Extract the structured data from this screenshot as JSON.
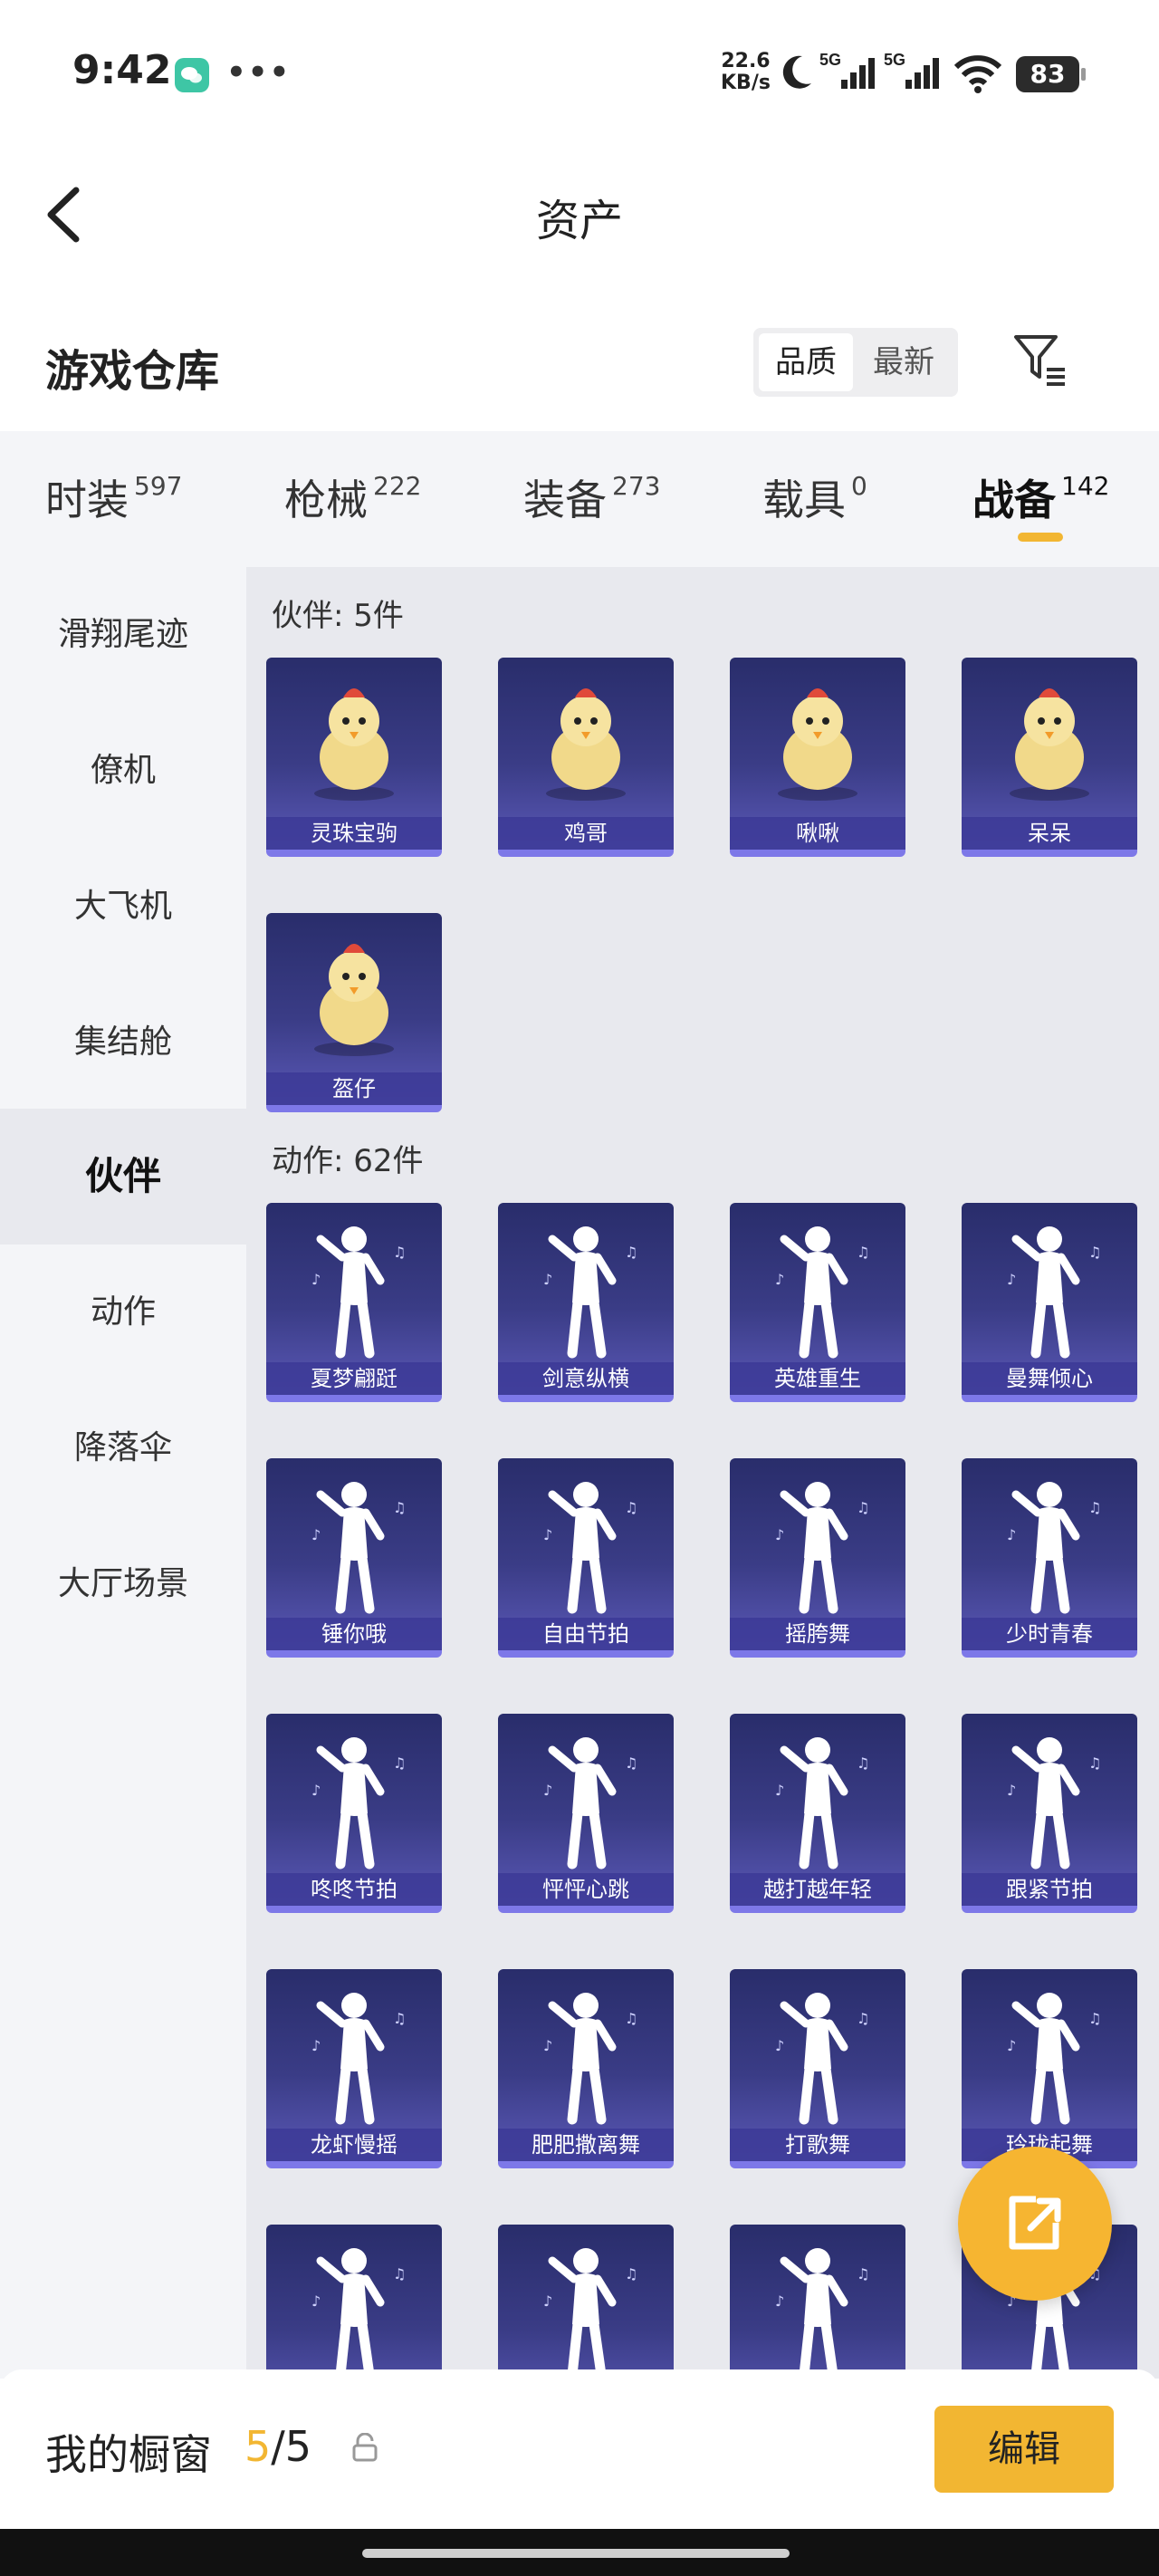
{
  "status_bar": {
    "time": "9:42",
    "net_speed_value": "22.6",
    "net_speed_unit": "KB/s",
    "battery": "83",
    "icons": [
      "wechat-icon",
      "more-dots-icon",
      "moon-icon",
      "signal-5g-icon",
      "signal-5g-icon",
      "wifi-icon",
      "battery-icon"
    ]
  },
  "nav": {
    "title": "资产",
    "back_icon": "chevron-left-icon"
  },
  "warehouse": {
    "title": "游戏仓库",
    "sort_options": [
      "品质",
      "最新"
    ],
    "sort_selected": "品质",
    "filter_icon": "filter-icon"
  },
  "category_tabs": [
    {
      "label": "时装",
      "count": "597"
    },
    {
      "label": "枪械",
      "count": "222"
    },
    {
      "label": "装备",
      "count": "273"
    },
    {
      "label": "载具",
      "count": "0"
    },
    {
      "label": "战备",
      "count": "142"
    }
  ],
  "active_tab": "战备",
  "sidebar": {
    "items": [
      "滑翔尾迹",
      "僚机",
      "大飞机",
      "集结舱",
      "伙伴",
      "动作",
      "降落伞",
      "大厅场景"
    ],
    "active": "伙伴"
  },
  "sections": {
    "partners": {
      "title": "伙伴: 5件",
      "items": [
        "灵珠宝驹",
        "鸡哥",
        "啾啾",
        "呆呆",
        "盔仔"
      ]
    },
    "emotes": {
      "title": "动作: 62件",
      "items": [
        "夏梦翩跹",
        "剑意纵横",
        "英雄重生",
        "曼舞倾心",
        "锤你哦",
        "自由节拍",
        "摇胯舞",
        "少时青春",
        "咚咚节拍",
        "怦怦心跳",
        "越打越年轻",
        "跟紧节拍",
        "龙虾慢摇",
        "肥肥撒离舞",
        "打歌舞",
        "玲珑起舞",
        "",
        "",
        "",
        ""
      ]
    }
  },
  "share_fab_icon": "share-icon",
  "bottom_bar": {
    "label": "我的橱窗",
    "current": "5",
    "separator": "/",
    "total": "5",
    "lock_icon": "lock-icon",
    "edit_label": "编辑"
  },
  "colors": {
    "accent": "#f2b632",
    "card_bg": "#2f3175",
    "card_border": "#7d78e8"
  }
}
